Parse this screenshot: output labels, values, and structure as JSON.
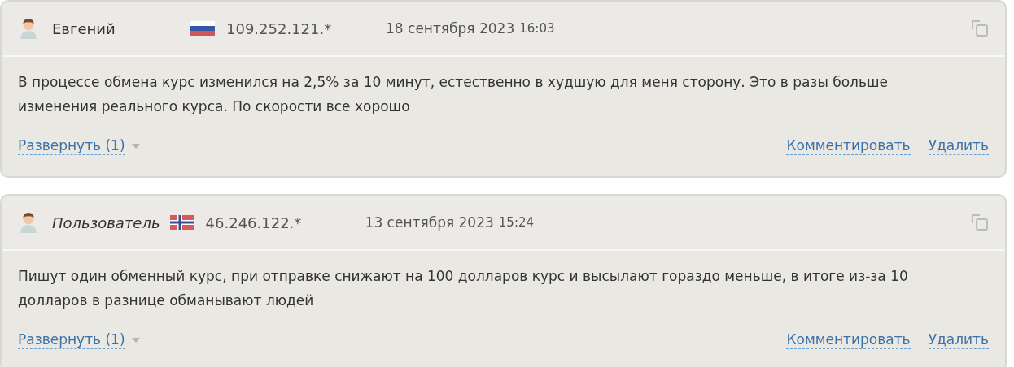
{
  "reviews": [
    {
      "author": "Евгений",
      "author_italic": false,
      "flag": {
        "kind": "ru"
      },
      "ip": "109.252.121.*",
      "date": "18 сентября 2023",
      "time": "16:03",
      "text": "В процессе обмена курс изменился на 2,5% за 10 минут, естественно в худшую для меня сторону. Это в разы больше изменения реального курса. По скорости все хорошо",
      "expand": "Развернуть (1)",
      "actions": [
        "Комментировать",
        "Удалить"
      ]
    },
    {
      "author": "Пользователь",
      "author_italic": true,
      "flag": {
        "kind": "no"
      },
      "ip": "46.246.122.*",
      "date": "13 сентября 2023",
      "time": "15:24",
      "text": "Пишут один обменный курс, при отправке снижают на 100 долларов курс и высылают гораздо меньше, в итоге из-за 10 долларов в разнице обманывают людей",
      "expand": "Развернуть (1)",
      "actions": [
        "Комментировать",
        "Удалить"
      ]
    }
  ]
}
